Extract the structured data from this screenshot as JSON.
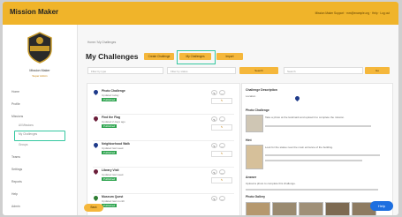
{
  "header": {
    "app_title": "Mission Maker",
    "info": "Mission Maker Support · mm@example.org · Help · Log out"
  },
  "sidebar": {
    "user_name": "Mission Maker",
    "user_sub": "Super Admin",
    "items": [
      {
        "label": "Home"
      },
      {
        "label": "Profile"
      },
      {
        "label": "Missions"
      },
      {
        "label": "All Missions"
      },
      {
        "label": "My Challenges"
      },
      {
        "label": "Groups"
      },
      {
        "label": "Teams"
      },
      {
        "label": "Settings"
      },
      {
        "label": "Reports"
      },
      {
        "label": "Help"
      },
      {
        "label": "Admin"
      }
    ]
  },
  "main": {
    "breadcrumb": "Home / My Challenges",
    "title": "My Challenges",
    "tabs": [
      {
        "label": "Create Challenge"
      },
      {
        "label": "My Challenges"
      },
      {
        "label": "Import"
      }
    ],
    "filters": {
      "type_placeholder": "Filter by type",
      "status_placeholder": "Filter by status",
      "search_btn": "Search",
      "search_placeholder": "Search",
      "go_btn": "Go"
    }
  },
  "challenges": [
    {
      "title": "Photo Challenge",
      "meta": "Updated today",
      "status": "Published",
      "color": "#1e3a8a"
    },
    {
      "title": "Find the Flag",
      "meta": "Updated 2 days ago",
      "status": "Published",
      "color": "#6b1e3a"
    },
    {
      "title": "Neighborhood Walk",
      "meta": "Updated last week",
      "status": "Published",
      "color": "#1e3a8a"
    },
    {
      "title": "Library Visit",
      "meta": "Updated last week",
      "status": "Published",
      "color": "#6b1e3a"
    },
    {
      "title": "Museum Quest",
      "meta": "Updated last month",
      "status": "Published",
      "color": "#2e7d32"
    }
  ],
  "detail": {
    "heading": "Challenge Description",
    "sub": "Location",
    "section1": "Photo Challenge",
    "section1_text": "Take a photo at the landmark and upload it to complete the mission.",
    "section2": "Hint",
    "section2_text": "Look for the statue near the main entrance of the building.",
    "section3": "Answer",
    "section3_text": "Upload a photo to complete this challenge.",
    "gallery_label": "Photo Gallery"
  },
  "help_label": "Help",
  "bottom_btn": "Back"
}
